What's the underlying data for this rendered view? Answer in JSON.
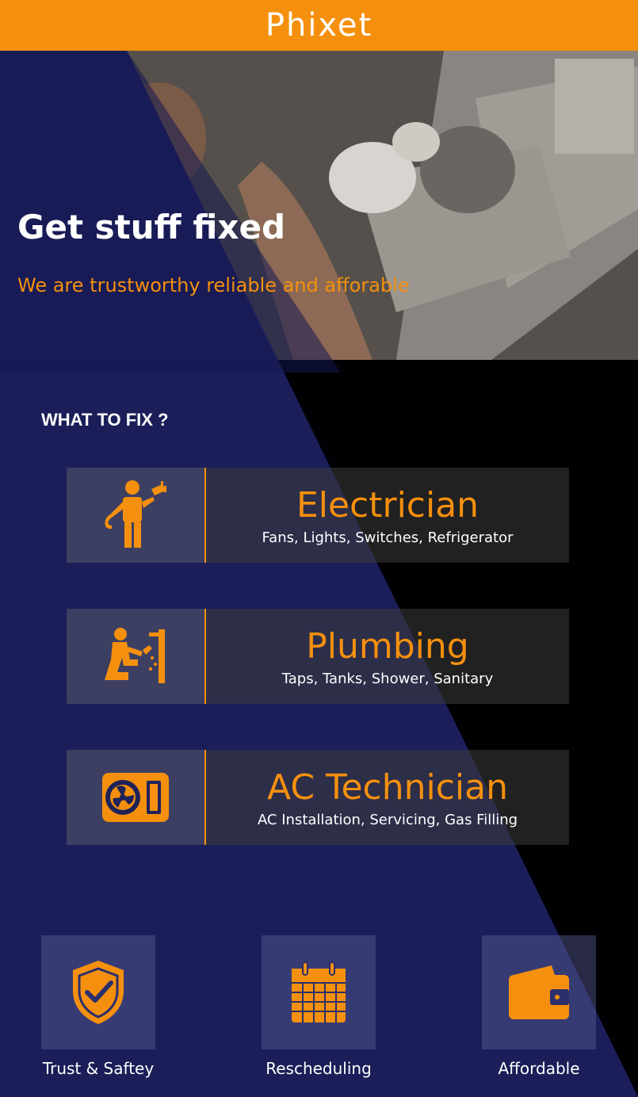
{
  "app": {
    "brand": "Phixet",
    "accent_color": "#f5900e"
  },
  "hero": {
    "title": "Get stuff fixed",
    "subtitle": "We are trustworthy reliable and afforable"
  },
  "services_heading": "WHAT TO FIX ?",
  "services": [
    {
      "name": "Electrician",
      "description": "Fans, Lights, Switches, Refrigerator",
      "icon": "electrician-icon"
    },
    {
      "name": "Plumbing",
      "description": "Taps, Tanks, Shower, Sanitary",
      "icon": "plumber-icon"
    },
    {
      "name": "AC Technician",
      "description": "AC Installation, Servicing, Gas Filling",
      "icon": "ac-unit-icon"
    }
  ],
  "features": [
    {
      "label": "Trust & Saftey",
      "icon": "shield-check-icon"
    },
    {
      "label": "Rescheduling",
      "icon": "calendar-icon"
    },
    {
      "label": "Affordable",
      "icon": "wallet-icon"
    }
  ]
}
